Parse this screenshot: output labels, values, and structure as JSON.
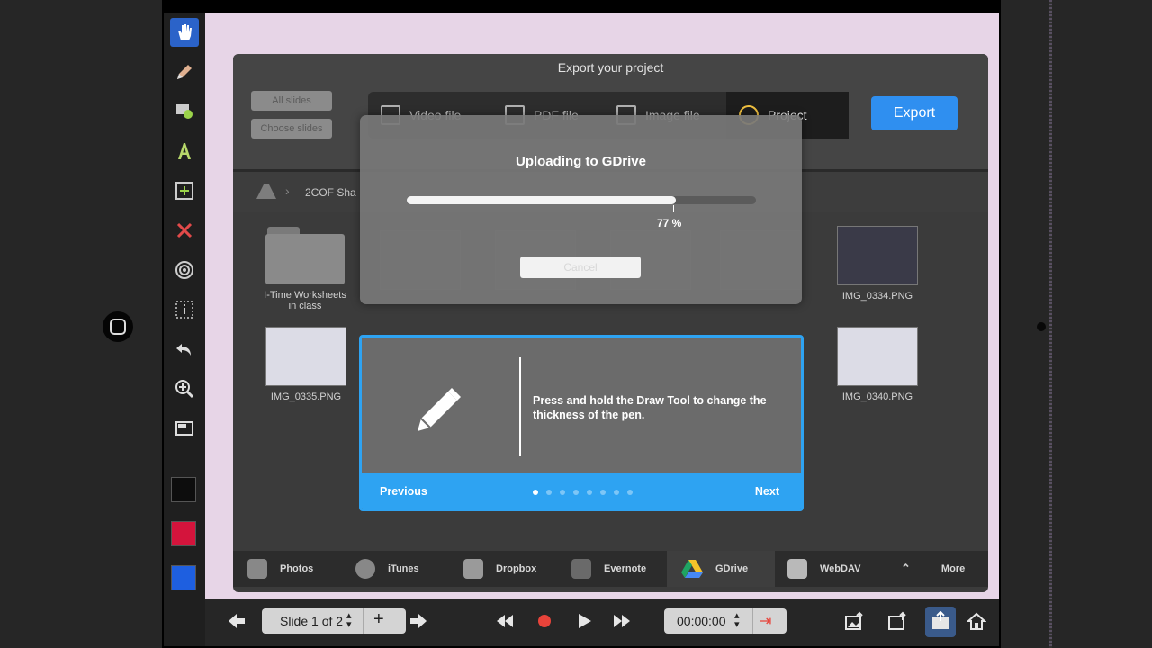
{
  "export_dialog": {
    "title": "Export your project",
    "scope_buttons": [
      "All slides",
      "Choose slides"
    ],
    "tabs": [
      "Video file",
      "PDF file",
      "Image file",
      "Project"
    ],
    "selected_tab": "Project",
    "export_label": "Export",
    "path_label": "2COF Sha",
    "files": [
      {
        "name": "I-Time Worksheets in class",
        "kind": "folder"
      },
      {
        "name": "IMG_0334.PNG",
        "kind": "image"
      },
      {
        "name": "IMG_0335.PNG",
        "kind": "image"
      },
      {
        "name": "IMG_0340.PNG",
        "kind": "image"
      }
    ],
    "services": [
      "Photos",
      "iTunes",
      "Dropbox",
      "Evernote",
      "GDrive",
      "WebDAV",
      "More"
    ],
    "selected_service": "GDrive"
  },
  "upload": {
    "title": "Uploading to GDrive",
    "progress": 0.77,
    "percent_label": "77 %",
    "cancel_label": "Cancel"
  },
  "tip": {
    "text": "Press and hold the Draw Tool to change the thickness of the pen.",
    "previous_label": "Previous",
    "next_label": "Next",
    "page_count": 8,
    "current_page": 1
  },
  "bottom_bar": {
    "slide_label": "Slide 1 of 2",
    "time_label": "00:00:00"
  },
  "colors": {
    "accent": "#2ea3f2",
    "export_button": "#2f8ff0",
    "swatch_black": "#0d0d0d",
    "swatch_red": "#d4143c",
    "swatch_blue": "#1e5fe0",
    "record": "#e8433a"
  },
  "icons": {
    "toolbar": [
      "hand-icon",
      "pencil-icon",
      "shape-icon",
      "text-icon",
      "add-box-icon",
      "delete-icon",
      "target-icon",
      "info-icon",
      "undo-icon",
      "zoom-icon",
      "background-icon"
    ],
    "bottom": [
      "previous-slide-icon",
      "next-slide-icon",
      "rewind-icon",
      "record-icon",
      "play-icon",
      "fast-forward-icon",
      "image-export-icon",
      "share-icon",
      "export-icon",
      "home-icon"
    ]
  }
}
